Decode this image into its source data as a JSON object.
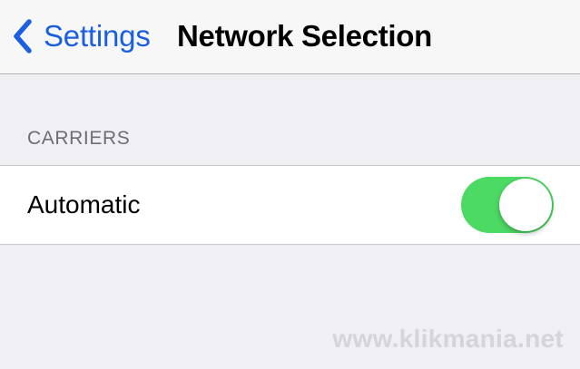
{
  "nav": {
    "back_label": "Settings",
    "back_icon": "chevron-left-icon",
    "title": "Network Selection"
  },
  "section": {
    "header": "CARRIERS"
  },
  "rows": [
    {
      "label": "Automatic",
      "toggle_on": true
    }
  ],
  "colors": {
    "accent": "#1a5fe0",
    "toggle_on": "#4cd964",
    "background": "#efeff4"
  },
  "watermark": "www.klikmania.net"
}
